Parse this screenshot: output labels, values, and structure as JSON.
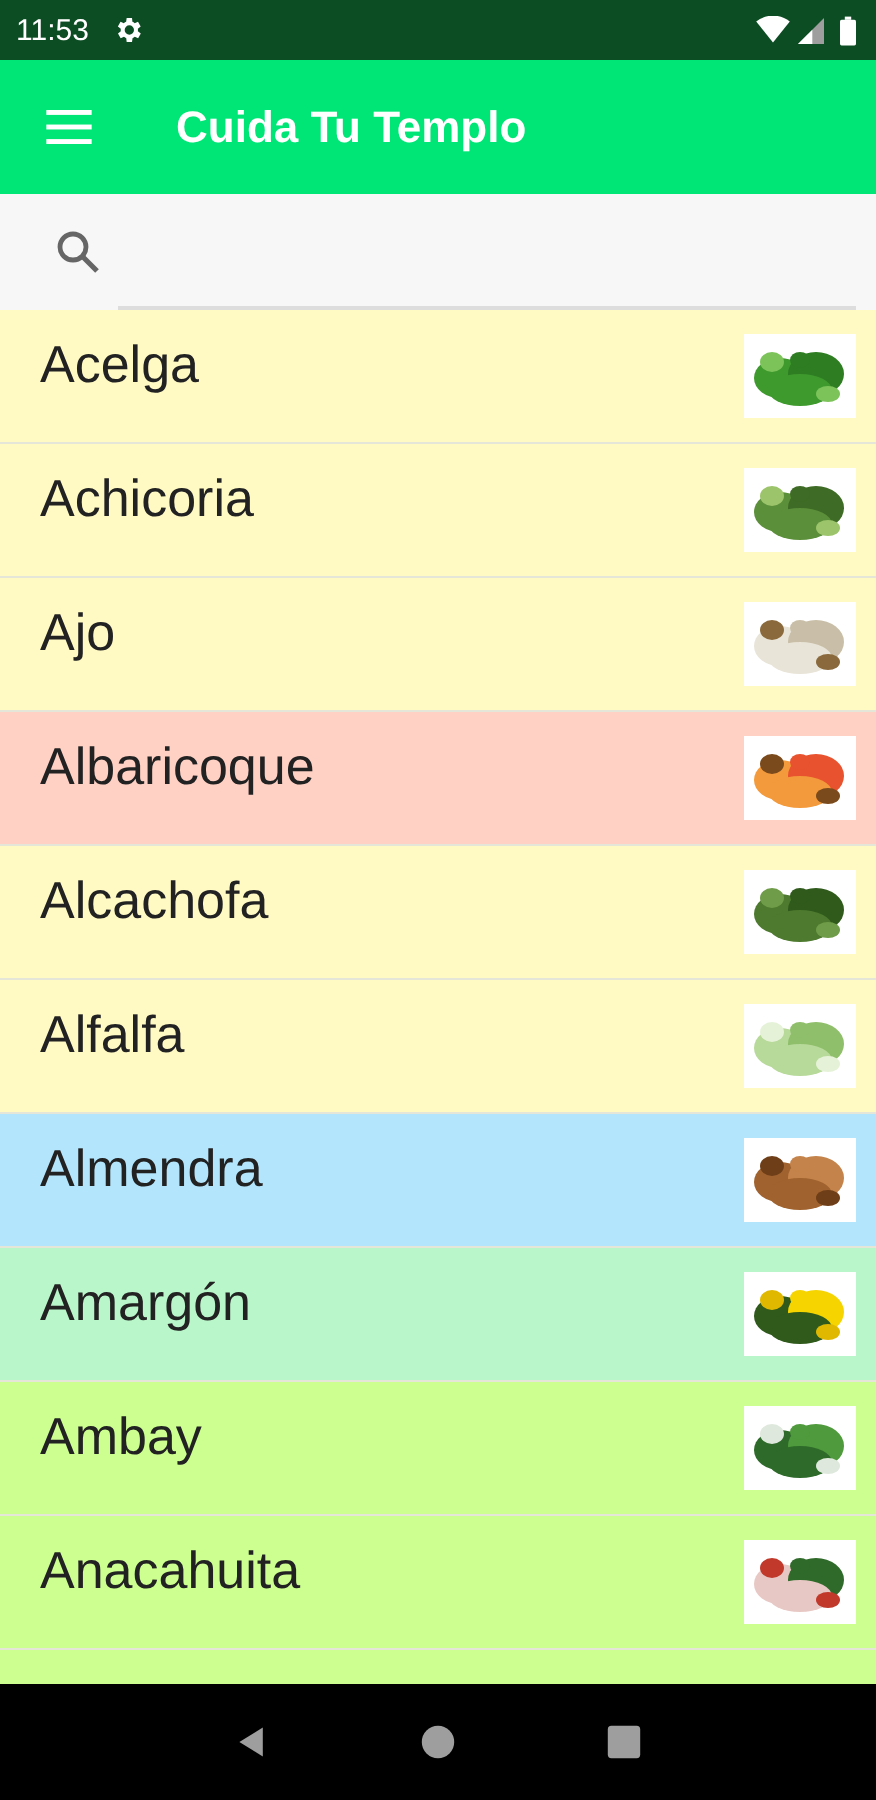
{
  "status_bar": {
    "time": "11:53"
  },
  "app_bar": {
    "title": "Cuida Tu Templo"
  },
  "items": [
    {
      "name": "Acelga",
      "color": "#fff9c4",
      "kind": "picture"
    },
    {
      "name": "Achicoria",
      "color": "#fff9c4",
      "kind": "picture"
    },
    {
      "name": "Ajo",
      "color": "#fff9c4",
      "kind": "picture"
    },
    {
      "name": "Albaricoque",
      "color": "#ffd0c4",
      "kind": "picture"
    },
    {
      "name": "Alcachofa",
      "color": "#fff9c4",
      "kind": "picture"
    },
    {
      "name": "Alfalfa",
      "color": "#fff9c4",
      "kind": "picture"
    },
    {
      "name": "Almendra",
      "color": "#b3e5fc",
      "kind": "picture"
    },
    {
      "name": "Amargón",
      "color": "#b9f6ca",
      "kind": "picture"
    },
    {
      "name": "Ambay",
      "color": "#ccff90",
      "kind": "picture"
    },
    {
      "name": "Anacahuita",
      "color": "#ccff90",
      "kind": "picture"
    }
  ]
}
